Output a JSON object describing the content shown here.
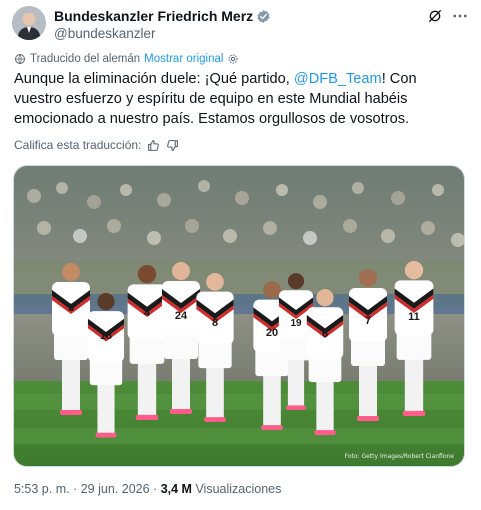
{
  "author": {
    "display_name": "Bundeskanzler Friedrich Merz",
    "handle": "@bundeskanzler",
    "verified_color": "#829aab"
  },
  "translation": {
    "notice": "Traducido del alemán",
    "show_original": "Mostrar original"
  },
  "tweet": {
    "text_before": "Aunque la eliminación duele: ¡Qué partido, ",
    "mention": "@DFB_Team",
    "text_after": "! Con vuestro esfuerzo y espíritu de equipo en este Mundial habéis emocionado a nuestro país. Estamos orgullosos de vosotros."
  },
  "rating": {
    "label": "Califica esta traducción:"
  },
  "media": {
    "credit": "Foto: Getty Images/Robert Cianflone",
    "jersey_numbers": [
      "3",
      "18",
      "4",
      "24",
      "8",
      "20",
      "19",
      "6",
      "7",
      "11"
    ]
  },
  "meta": {
    "time": "5:53 p. m.",
    "date": "29 jun. 2026",
    "separator": "·",
    "views_count": "3,4 M",
    "views_label": "Visualizaciones"
  },
  "colors": {
    "link": "#1d9bf0",
    "secondary_text": "#536471",
    "primary_text": "#0f1419"
  }
}
